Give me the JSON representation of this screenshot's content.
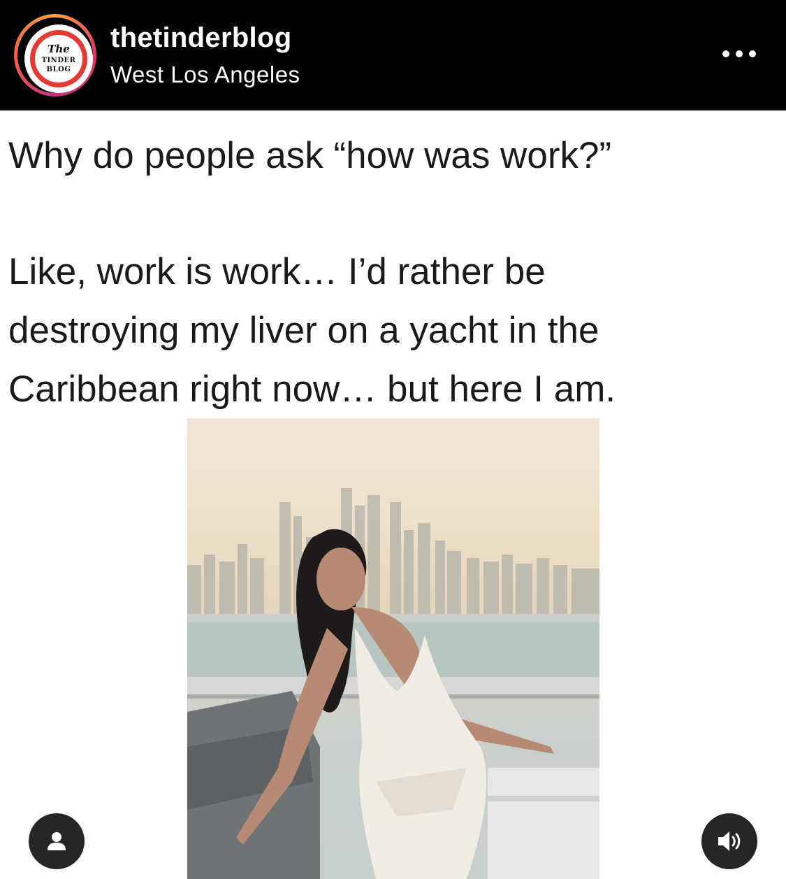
{
  "header": {
    "username": "thetinderblog",
    "location": "West Los Angeles",
    "avatar": {
      "line1": "The",
      "line2": "TINDER",
      "line3": "BLOG"
    },
    "more_icon": "more-horizontal-icon"
  },
  "caption": {
    "line1": "Why do people ask “how was work?”",
    "line2": "Like, work is work… I’d rather be",
    "line3": "destroying my liver on a yacht in the",
    "line4": "Caribbean right now… but here I am."
  },
  "controls": {
    "tagged_icon": "user-icon",
    "sound_icon": "speaker-icon"
  },
  "colors": {
    "header_bg": "#000000",
    "text": "#1a1a1a",
    "button_bg": "#262626",
    "logo_red": "#e53935"
  }
}
